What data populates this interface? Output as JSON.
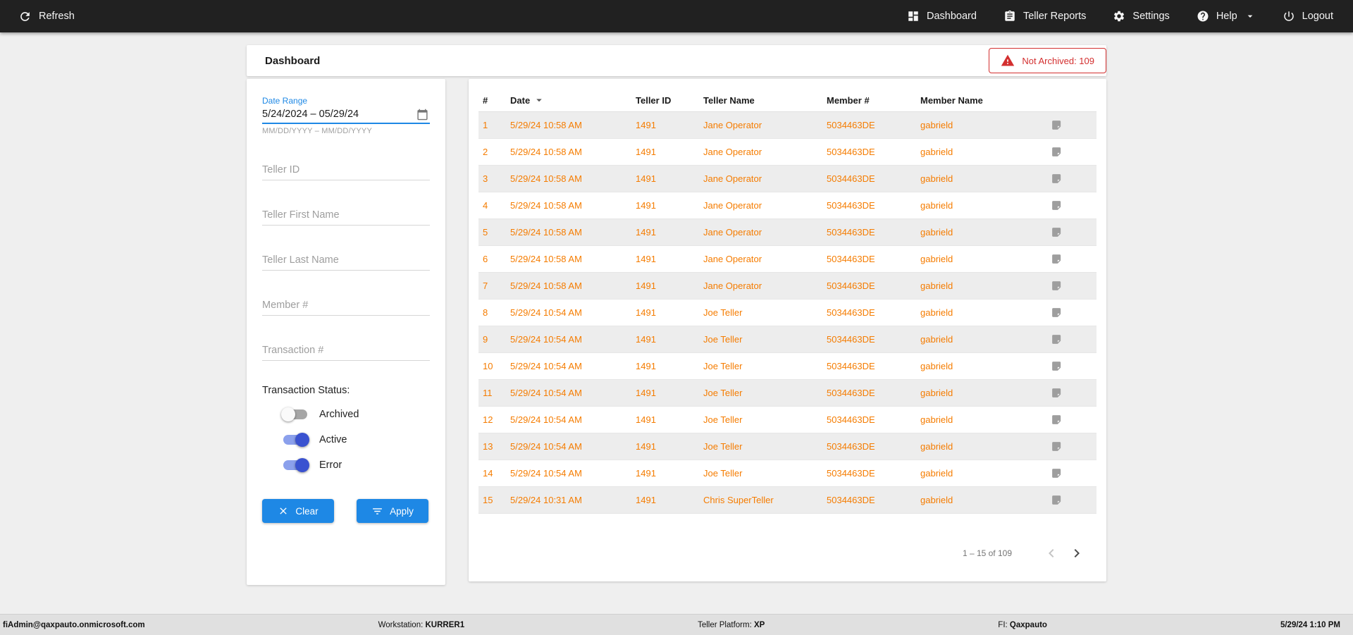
{
  "topbar": {
    "refresh_label": "Refresh",
    "nav": [
      {
        "label": "Dashboard"
      },
      {
        "label": "Teller Reports"
      },
      {
        "label": "Settings"
      },
      {
        "label": "Help"
      },
      {
        "label": "Logout"
      }
    ]
  },
  "header": {
    "title": "Dashboard",
    "not_archived_badge": "Not Archived: 109"
  },
  "filters": {
    "date_range": {
      "label": "Date Range",
      "value": "5/24/2024 – 05/29/24",
      "hint": "MM/DD/YYYY – MM/DD/YYYY"
    },
    "fields": [
      {
        "placeholder": "Teller ID"
      },
      {
        "placeholder": "Teller First Name"
      },
      {
        "placeholder": "Teller Last Name"
      },
      {
        "placeholder": "Member #"
      },
      {
        "placeholder": "Transaction #"
      }
    ],
    "status_label": "Transaction Status:",
    "toggles": [
      {
        "label": "Archived",
        "on": false
      },
      {
        "label": "Active",
        "on": true
      },
      {
        "label": "Error",
        "on": true
      }
    ],
    "buttons": {
      "clear": "Clear",
      "apply": "Apply"
    }
  },
  "table": {
    "columns": {
      "num": "#",
      "date": "Date",
      "teller_id": "Teller ID",
      "teller_name": "Teller Name",
      "member_num": "Member #",
      "member_name": "Member Name"
    },
    "rows": [
      {
        "num": "1",
        "date": "5/29/24 10:58 AM",
        "teller_id": "1491",
        "teller_name": "Jane Operator",
        "member_num": "5034463DE",
        "member_name": "gabrield"
      },
      {
        "num": "2",
        "date": "5/29/24 10:58 AM",
        "teller_id": "1491",
        "teller_name": "Jane Operator",
        "member_num": "5034463DE",
        "member_name": "gabrield"
      },
      {
        "num": "3",
        "date": "5/29/24 10:58 AM",
        "teller_id": "1491",
        "teller_name": "Jane Operator",
        "member_num": "5034463DE",
        "member_name": "gabrield"
      },
      {
        "num": "4",
        "date": "5/29/24 10:58 AM",
        "teller_id": "1491",
        "teller_name": "Jane Operator",
        "member_num": "5034463DE",
        "member_name": "gabrield"
      },
      {
        "num": "5",
        "date": "5/29/24 10:58 AM",
        "teller_id": "1491",
        "teller_name": "Jane Operator",
        "member_num": "5034463DE",
        "member_name": "gabrield"
      },
      {
        "num": "6",
        "date": "5/29/24 10:58 AM",
        "teller_id": "1491",
        "teller_name": "Jane Operator",
        "member_num": "5034463DE",
        "member_name": "gabrield"
      },
      {
        "num": "7",
        "date": "5/29/24 10:58 AM",
        "teller_id": "1491",
        "teller_name": "Jane Operator",
        "member_num": "5034463DE",
        "member_name": "gabrield"
      },
      {
        "num": "8",
        "date": "5/29/24 10:54 AM",
        "teller_id": "1491",
        "teller_name": "Joe Teller",
        "member_num": "5034463DE",
        "member_name": "gabrield"
      },
      {
        "num": "9",
        "date": "5/29/24 10:54 AM",
        "teller_id": "1491",
        "teller_name": "Joe Teller",
        "member_num": "5034463DE",
        "member_name": "gabrield"
      },
      {
        "num": "10",
        "date": "5/29/24 10:54 AM",
        "teller_id": "1491",
        "teller_name": "Joe Teller",
        "member_num": "5034463DE",
        "member_name": "gabrield"
      },
      {
        "num": "11",
        "date": "5/29/24 10:54 AM",
        "teller_id": "1491",
        "teller_name": "Joe Teller",
        "member_num": "5034463DE",
        "member_name": "gabrield"
      },
      {
        "num": "12",
        "date": "5/29/24 10:54 AM",
        "teller_id": "1491",
        "teller_name": "Joe Teller",
        "member_num": "5034463DE",
        "member_name": "gabrield"
      },
      {
        "num": "13",
        "date": "5/29/24 10:54 AM",
        "teller_id": "1491",
        "teller_name": "Joe Teller",
        "member_num": "5034463DE",
        "member_name": "gabrield"
      },
      {
        "num": "14",
        "date": "5/29/24 10:54 AM",
        "teller_id": "1491",
        "teller_name": "Joe Teller",
        "member_num": "5034463DE",
        "member_name": "gabrield"
      },
      {
        "num": "15",
        "date": "5/29/24 10:31 AM",
        "teller_id": "1491",
        "teller_name": "Chris SuperTeller",
        "member_num": "5034463DE",
        "member_name": "gabrield"
      }
    ],
    "pagination": {
      "range_label": "1 – 15 of 109"
    }
  },
  "footer": {
    "user_email": "fiAdmin@qaxpauto.onmicrosoft.com",
    "workstation_label": "Workstation:",
    "workstation_value": "KURRER1",
    "platform_label": "Teller Platform:",
    "platform_value": "XP",
    "fi_label": "FI:",
    "fi_value": "Qaxpauto",
    "datetime": "5/29/24 1:10 PM"
  },
  "colors": {
    "topbar_bg": "#212121",
    "accent_blue": "#1e88e5",
    "toggle_on_blue": "#3a52d0",
    "row_text_orange": "#f57c00",
    "error_red": "#d32f2f",
    "stripe_gray": "#ededed"
  }
}
